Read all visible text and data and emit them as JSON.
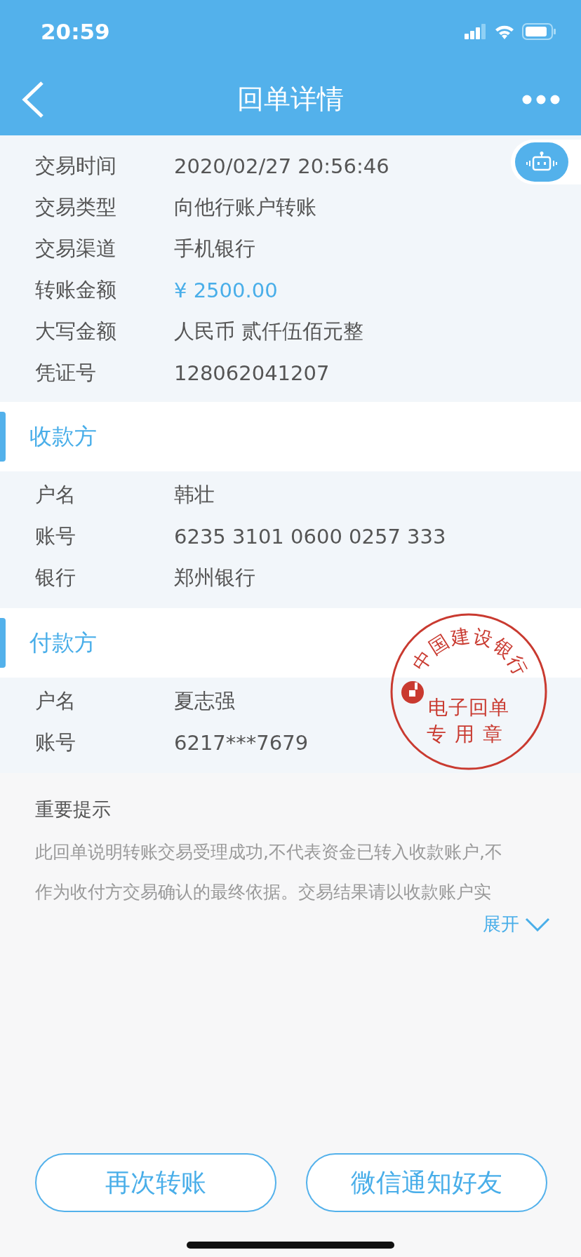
{
  "status_bar": {
    "time": "20:59"
  },
  "nav": {
    "title": "回单详情"
  },
  "details": [
    {
      "label": "交易时间",
      "value": "2020/02/27 20:56:46",
      "kind": "plain"
    },
    {
      "label": "交易类型",
      "value": "向他行账户转账",
      "kind": "plain"
    },
    {
      "label": "交易渠道",
      "value": "手机银行",
      "kind": "plain"
    },
    {
      "label": "转账金额",
      "value": "¥ 2500.00",
      "kind": "amount"
    },
    {
      "label": "大写金额",
      "value": "人民币 贰仟伍佰元整",
      "kind": "plain"
    },
    {
      "label": "凭证号",
      "value": "128062041207",
      "kind": "plain"
    }
  ],
  "sections": [
    {
      "title": "收款方",
      "rows": [
        {
          "label": "户名",
          "value": "韩壮"
        },
        {
          "label": "账号",
          "value": "6235 3101 0600 0257 333"
        },
        {
          "label": "银行",
          "value": "郑州银行"
        }
      ]
    },
    {
      "title": "付款方",
      "rows": [
        {
          "label": "户名",
          "value": "夏志强"
        },
        {
          "label": "账号",
          "value": "6217***7679"
        }
      ]
    }
  ],
  "stamp": {
    "ring_chars": [
      "中",
      "国",
      "建",
      "设",
      "银",
      "行"
    ],
    "lines": [
      "电子回单",
      "专用章"
    ]
  },
  "notice": {
    "title": "重要提示",
    "lines": [
      "此回单说明转账交易受理成功,不代表资金已转入收款账户,不",
      "作为收付方交易确认的最终依据。交易结果请以收款账户实"
    ],
    "expand_label": "展开"
  },
  "buttons": [
    "再次转账",
    "微信通知好友"
  ]
}
